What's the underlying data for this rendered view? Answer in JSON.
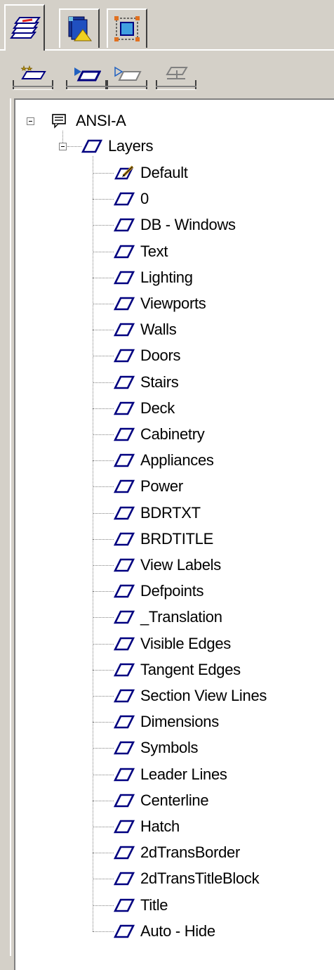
{
  "tabs": [
    {
      "id": "layers",
      "icon": "layers-tab-icon",
      "active": true
    },
    {
      "id": "views",
      "icon": "views-tab-icon",
      "active": false
    },
    {
      "id": "selection",
      "icon": "selection-tab-icon",
      "active": false
    }
  ],
  "toolbar": [
    {
      "id": "new-layer",
      "icon": "new-layer-icon",
      "enabled": true
    },
    {
      "id": "show-layer",
      "icon": "show-layer-icon",
      "enabled": true
    },
    {
      "id": "hide-layer",
      "icon": "hide-layer-icon",
      "enabled": true
    },
    {
      "id": "layer-properties",
      "icon": "layer-properties-icon",
      "enabled": false
    }
  ],
  "tree": {
    "root": {
      "label": "ANSI-A",
      "icon": "sheet-icon",
      "expanded": true
    },
    "group": {
      "label": "Layers",
      "icon": "layer-icon",
      "expanded": true
    },
    "layers": [
      {
        "label": "Default",
        "icon": "active-layer-icon",
        "active": true
      },
      {
        "label": "0",
        "icon": "layer-icon"
      },
      {
        "label": "DB - Windows",
        "icon": "layer-icon"
      },
      {
        "label": "Text",
        "icon": "layer-icon"
      },
      {
        "label": "Lighting",
        "icon": "layer-icon"
      },
      {
        "label": "Viewports",
        "icon": "layer-icon"
      },
      {
        "label": "Walls",
        "icon": "layer-icon"
      },
      {
        "label": "Doors",
        "icon": "layer-icon"
      },
      {
        "label": "Stairs",
        "icon": "layer-icon"
      },
      {
        "label": "Deck",
        "icon": "layer-icon"
      },
      {
        "label": "Cabinetry",
        "icon": "layer-icon"
      },
      {
        "label": "Appliances",
        "icon": "layer-icon"
      },
      {
        "label": "Power",
        "icon": "layer-icon"
      },
      {
        "label": "BDRTXT",
        "icon": "layer-icon"
      },
      {
        "label": "BRDTITLE",
        "icon": "layer-icon"
      },
      {
        "label": "View Labels",
        "icon": "layer-icon"
      },
      {
        "label": "Defpoints",
        "icon": "layer-icon"
      },
      {
        "label": "_Translation",
        "icon": "layer-icon"
      },
      {
        "label": "Visible Edges",
        "icon": "layer-icon"
      },
      {
        "label": "Tangent Edges",
        "icon": "layer-icon"
      },
      {
        "label": "Section View Lines",
        "icon": "layer-icon"
      },
      {
        "label": "Dimensions",
        "icon": "layer-icon"
      },
      {
        "label": "Symbols",
        "icon": "layer-icon"
      },
      {
        "label": "Leader Lines",
        "icon": "layer-icon"
      },
      {
        "label": "Centerline",
        "icon": "layer-icon"
      },
      {
        "label": "Hatch",
        "icon": "layer-icon"
      },
      {
        "label": "2dTransBorder",
        "icon": "layer-icon"
      },
      {
        "label": "2dTransTitleBlock",
        "icon": "layer-icon"
      },
      {
        "label": "Title",
        "icon": "layer-icon"
      },
      {
        "label": "Auto - Hide",
        "icon": "layer-icon"
      }
    ]
  },
  "colors": {
    "face": "#d4d0c8",
    "highlight": "#ffffff",
    "shadow": "#808080",
    "dark_shadow": "#404040",
    "tree_bg": "#ffffff",
    "layer_icon_blue": "#000080"
  }
}
